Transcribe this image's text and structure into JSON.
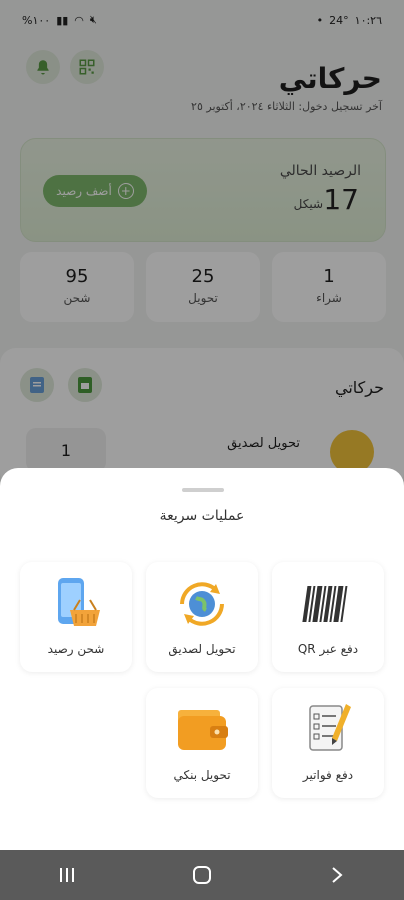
{
  "status_bar": {
    "time": "١٠:٢٦",
    "battery": "%١٠٠",
    "temperature": "24°"
  },
  "header": {
    "title": "حركاتي",
    "subtitle": "آخر تسجيل دخول: الثلاثاء ٢٠٢٤، أكتوبر ٢٥"
  },
  "balance": {
    "label": "الرصيد الحالي",
    "amount": "17",
    "currency": "شيكل",
    "add_label": "أضف رصيد"
  },
  "stats": [
    {
      "value": "1",
      "label": "شراء"
    },
    {
      "value": "25",
      "label": "تحويل"
    },
    {
      "value": "95",
      "label": "شحن"
    }
  ],
  "section": {
    "title": "حركاتي",
    "item": {
      "name": "تحويل لصديق",
      "count": "1"
    }
  },
  "sheet": {
    "title": "عمليات سريعة",
    "actions": [
      {
        "label": "دفع عبر QR",
        "icon": "barcode-icon"
      },
      {
        "label": "تحويل لصديق",
        "icon": "globe-transfer-icon"
      },
      {
        "label": "شحن رصيد",
        "icon": "phone-basket-icon"
      },
      {
        "label": "دفع فواتير",
        "icon": "bill-checklist-icon"
      },
      {
        "label": "تحويل بنكي",
        "icon": "wallet-icon"
      }
    ]
  },
  "colors": {
    "accent": "#7fb96c",
    "overlay": "rgba(0,0,0,0.38)"
  }
}
